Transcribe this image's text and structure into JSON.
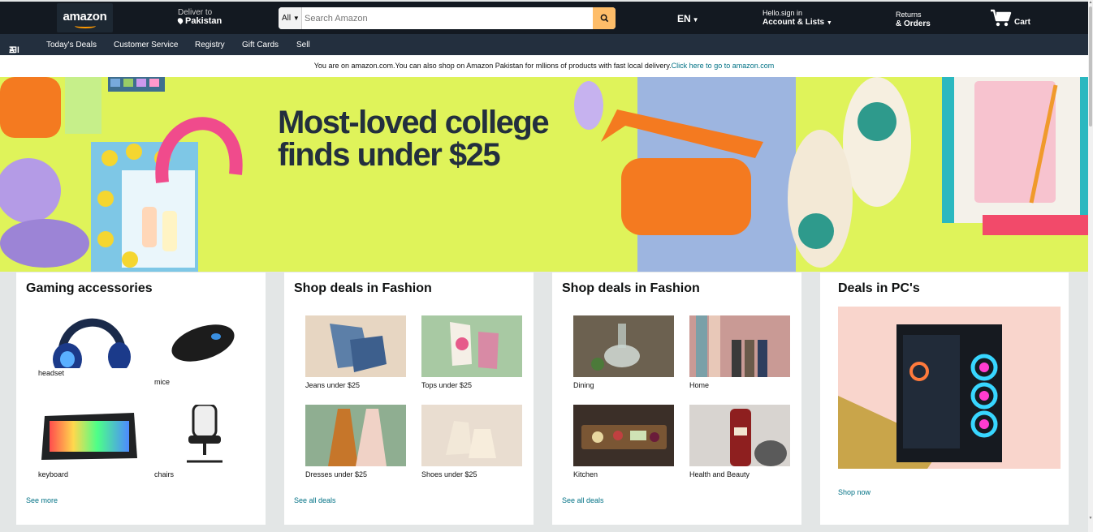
{
  "header": {
    "logo_text": "amazon",
    "deliver_label": "Deliver to",
    "deliver_location": "Pakistan",
    "search_category": "All",
    "search_placeholder": "Search Amazon",
    "language": "EN",
    "account_greeting": "Hello.sign in",
    "account_label": "Account & Lists",
    "returns_label": "Returns",
    "orders_label": "& Orders",
    "cart_label": "Cart",
    "brand_color": "#131921",
    "accent_color": "#febd69"
  },
  "nav": {
    "all_label": "All",
    "items": [
      "Today's Deals",
      "Customer Service",
      "Registry",
      "Gift Cards",
      "Sell"
    ]
  },
  "notice": {
    "text": "You are on amazon.com.You can also shop on Amazon Pakistan for mllions of products with fast local delivery.",
    "link": "Click here to go to amazon.com"
  },
  "hero": {
    "headline_line1": "Most-loved college",
    "headline_line2": "finds under $25"
  },
  "cards": [
    {
      "title": "Gaming accessories",
      "link": "See more",
      "items": [
        "headset",
        "mice",
        "keyboard",
        "chairs"
      ]
    },
    {
      "title": "Shop deals in Fashion",
      "link": "See all deals",
      "items": [
        "Jeans under $25",
        "Tops under $25",
        "Dresses under $25",
        "Shoes under $25"
      ]
    },
    {
      "title": "Shop deals in Fashion",
      "link": "See all deals",
      "items": [
        "Dining",
        "Home",
        "Kitchen",
        "Health and Beauty"
      ]
    },
    {
      "title": "Deals in PC's",
      "link": "Shop now"
    }
  ]
}
